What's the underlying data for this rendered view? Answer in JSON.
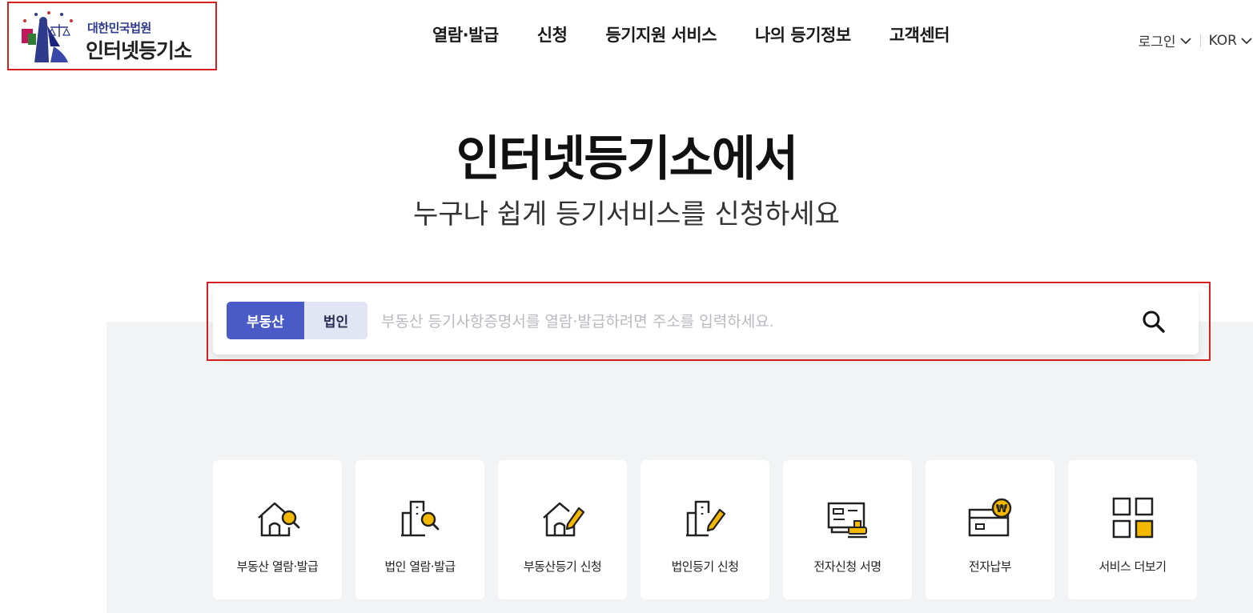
{
  "header": {
    "logo_org": "대한민국법원",
    "logo_name": "인터넷등기소",
    "nav": [
      "열람·발급",
      "신청",
      "등기지원 서비스",
      "나의 등기정보",
      "고객센터"
    ],
    "login_label": "로그인",
    "lang_label": "KOR"
  },
  "hero": {
    "title": "인터넷등기소에서",
    "subtitle": "누구나 쉽게 등기서비스를 신청하세요"
  },
  "search": {
    "tab_realestate": "부동산",
    "tab_corp": "법인",
    "placeholder": "부동산 등기사항증명서를 열람·발급하려면 주소를 입력하세요.",
    "active_tab": "부동산"
  },
  "quick_menu": [
    {
      "label": "부동산 열람·발급",
      "icon": "house-search-icon"
    },
    {
      "label": "법인 열람·발급",
      "icon": "building-search-icon"
    },
    {
      "label": "부동산등기 신청",
      "icon": "house-pen-icon"
    },
    {
      "label": "법인등기 신청",
      "icon": "building-pen-icon"
    },
    {
      "label": "전자신청 서명",
      "icon": "document-stamp-icon"
    },
    {
      "label": "전자납부",
      "icon": "card-won-icon"
    },
    {
      "label": "서비스 더보기",
      "icon": "grid-more-icon"
    }
  ],
  "colors": {
    "accent_blue": "#4a5bc7",
    "tab_inactive": "#e2e5f3",
    "highlight_red": "#d42020",
    "icon_yellow": "#f5b800",
    "section_gray": "#f2f3f5"
  }
}
